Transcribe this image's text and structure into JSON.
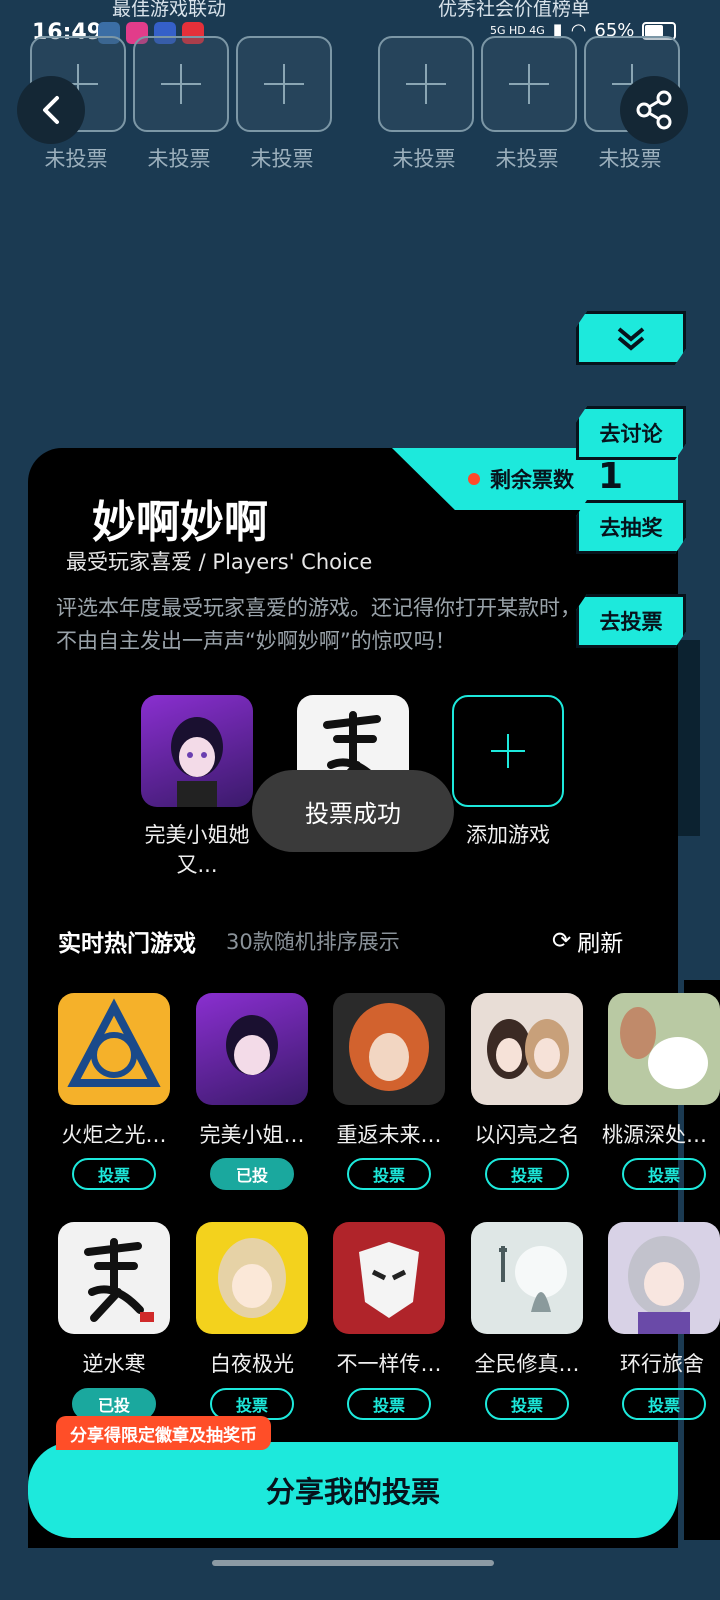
{
  "status": {
    "time": "16:49",
    "network": "5G HD 4G",
    "battery": "65%"
  },
  "top": {
    "left_category": "最佳游戏联动",
    "right_category": "优秀社会价值榜单",
    "slot_label": "未投票"
  },
  "side_tabs": {
    "discuss": "去讨论",
    "lottery": "去抽奖",
    "vote": "去投票"
  },
  "card": {
    "remaining_label": "剩余票数",
    "remaining_count": "1",
    "title": "妙啊妙啊",
    "subtitle": "最受玩家喜爱 / Players' Choice",
    "description": "评选本年度最受玩家喜爱的游戏。还记得你打开某款时，不由自主发出一声声“妙啊妙啊”的惊叹吗！",
    "picks": [
      {
        "name": "完美小姐她又...",
        "icon": "anime-girl-icon"
      },
      {
        "name": "",
        "icon": "calligraphy-han-icon"
      }
    ],
    "add_game_label": "添加游戏"
  },
  "toast": "投票成功",
  "hot": {
    "title": "实时热门游戏",
    "subtitle": "30款随机排序展示",
    "refresh_label": "刷新",
    "row1": [
      {
        "name": "火炬之光…",
        "vote": "投票",
        "voted": false,
        "color": "#f5b12a"
      },
      {
        "name": "完美小姐…",
        "vote": "已投",
        "voted": true,
        "color": "#5a2a8c"
      },
      {
        "name": "重返未来…",
        "vote": "投票",
        "voted": false,
        "color": "#c9562e"
      },
      {
        "name": "以闪亮之名",
        "vote": "投票",
        "voted": false,
        "color": "#d9c4b8"
      },
      {
        "name": "桃源深处…",
        "vote": "投票",
        "voted": false,
        "color": "#b9c9a3"
      }
    ],
    "row2": [
      {
        "name": "逆水寒",
        "vote": "已投",
        "voted": true,
        "color": "#f2f2f2"
      },
      {
        "name": "白夜极光",
        "vote": "投票",
        "voted": false,
        "color": "#f3d21d"
      },
      {
        "name": "不一样传…",
        "vote": "投票",
        "voted": false,
        "color": "#b0242a"
      },
      {
        "name": "全民修真…",
        "vote": "投票",
        "voted": false,
        "color": "#dfe7e6"
      },
      {
        "name": "环行旅舍",
        "vote": "投票",
        "voted": false,
        "color": "#d8d2e6"
      }
    ]
  },
  "share": {
    "badge": "分享得限定徽章及抽奖币",
    "button": "分享我的投票"
  }
}
